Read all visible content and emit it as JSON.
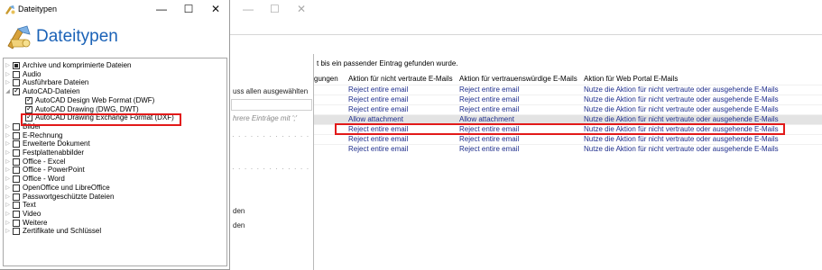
{
  "dialog": {
    "title": "Dateitypen",
    "header": "Dateitypen",
    "controls": {
      "minimize": "—",
      "maximize": "☐",
      "close": "✕"
    },
    "tree": [
      {
        "label": "Archive und komprimierte Dateien",
        "state": "partial",
        "expander": "▷",
        "level": 0
      },
      {
        "label": "Audio",
        "state": "unchecked",
        "expander": "▷",
        "level": 0
      },
      {
        "label": "Ausführbare Dateien",
        "state": "unchecked",
        "expander": "▷",
        "level": 0
      },
      {
        "label": "AutoCAD-Dateien",
        "state": "checked",
        "expander": "◢",
        "level": 0
      },
      {
        "label": "AutoCAD Design Web Format (DWF)",
        "state": "checked",
        "expander": "",
        "level": 1
      },
      {
        "label": "AutoCAD Drawing (DWG, DWT)",
        "state": "checked",
        "expander": "",
        "level": 1
      },
      {
        "label": "AutoCAD Drawing Exchange Format (DXF)",
        "state": "checked",
        "expander": "",
        "level": 1
      },
      {
        "label": "Bilder",
        "state": "unchecked",
        "expander": "▷",
        "level": 0
      },
      {
        "label": "E-Rechnung",
        "state": "unchecked",
        "expander": "▷",
        "level": 0
      },
      {
        "label": "Erweiterte Dokument",
        "state": "unchecked",
        "expander": "▷",
        "level": 0
      },
      {
        "label": "Festplattenabbilder",
        "state": "unchecked",
        "expander": "▷",
        "level": 0
      },
      {
        "label": "Office - Excel",
        "state": "unchecked",
        "expander": "▷",
        "level": 0
      },
      {
        "label": "Office - PowerPoint",
        "state": "unchecked",
        "expander": "▷",
        "level": 0
      },
      {
        "label": "Office - Word",
        "state": "unchecked",
        "expander": "▷",
        "level": 0
      },
      {
        "label": "OpenOffice und LibreOffice",
        "state": "unchecked",
        "expander": "▷",
        "level": 0
      },
      {
        "label": "Passwortgeschützte Dateien",
        "state": "unchecked",
        "expander": "▷",
        "level": 0
      },
      {
        "label": "Text",
        "state": "unchecked",
        "expander": "▷",
        "level": 0
      },
      {
        "label": "Video",
        "state": "unchecked",
        "expander": "▷",
        "level": 0
      },
      {
        "label": "Weitere",
        "state": "unchecked",
        "expander": "▷",
        "level": 0
      },
      {
        "label": "Zertifikate und Schlüssel",
        "state": "unchecked",
        "expander": "▷",
        "level": 0
      }
    ]
  },
  "background": {
    "controls": {
      "minimize": "—",
      "maximize": "☐",
      "close": "✕"
    },
    "left_text_1": "uss allen ausgewählten",
    "placeholder": "hrere Einträge mit ';'",
    "left_text_2": "den",
    "left_text_3": "den",
    "message": "t bis ein passender Eintrag gefunden wurde.",
    "grid": {
      "columns": [
        "gungen",
        "Aktion für nicht vertraute E-Mails",
        "Aktion für vertrauenswürdige E-Mails",
        "Aktion für Web Portal E-Mails"
      ],
      "rows": [
        [
          "Reject entire email",
          "Reject entire email",
          "Nutze die Aktion für nicht vertraute oder ausgehende E-Mails"
        ],
        [
          "Reject entire email",
          "Reject entire email",
          "Nutze die Aktion für nicht vertraute oder ausgehende E-Mails"
        ],
        [
          "Reject entire email",
          "Reject entire email",
          "Nutze die Aktion für nicht vertraute oder ausgehende E-Mails"
        ],
        [
          "Allow attachment",
          "Allow attachment",
          "Nutze die Aktion für nicht vertraute oder ausgehende E-Mails"
        ],
        [
          "Reject entire email",
          "Reject entire email",
          "Nutze die Aktion für nicht vertraute oder ausgehende E-Mails"
        ],
        [
          "Reject entire email",
          "Reject entire email",
          "Nutze die Aktion für nicht vertraute oder ausgehende E-Mails"
        ],
        [
          "Reject entire email",
          "Reject entire email",
          "Nutze die Aktion für nicht vertraute oder ausgehende E-Mails"
        ]
      ],
      "selected_row": 3
    }
  },
  "colors": {
    "accent": "#1a62b7",
    "highlight": "#e21a1a",
    "link": "#1f2e8c"
  }
}
